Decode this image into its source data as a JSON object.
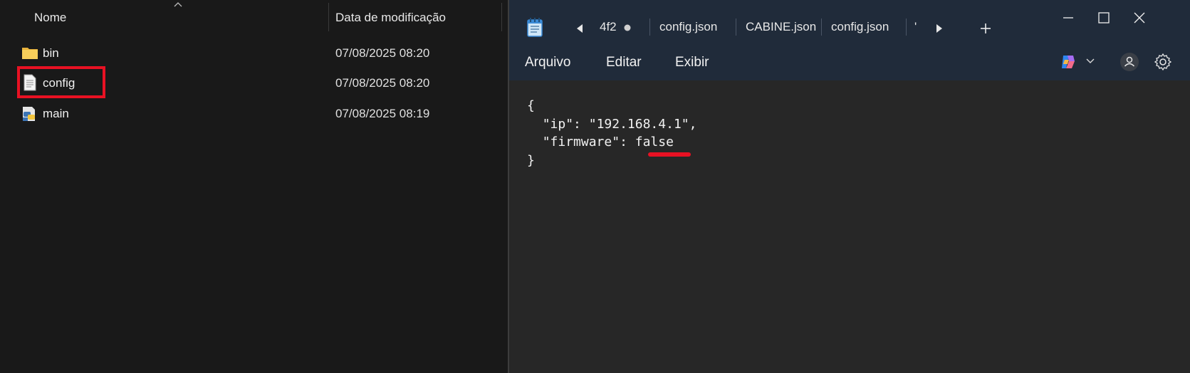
{
  "explorer": {
    "columns": {
      "name": "Nome",
      "date": "Data de modificação"
    },
    "rows": [
      {
        "name": "bin",
        "date": "07/08/2025 08:20",
        "icon": "folder-icon"
      },
      {
        "name": "config",
        "date": "07/08/2025 08:20",
        "icon": "text-file-icon"
      },
      {
        "name": "main",
        "date": "07/08/2025 08:19",
        "icon": "python-file-icon"
      }
    ],
    "highlight_color": "#e81123"
  },
  "notepad": {
    "tabs": [
      {
        "label": "4f2"
      },
      {
        "label": "config.json"
      },
      {
        "label": "CABINE.json"
      },
      {
        "label": "config.json"
      },
      {
        "label": "'"
      }
    ],
    "menu": {
      "file": "Arquivo",
      "edit": "Editar",
      "view": "Exibir"
    },
    "content": {
      "open_brace": "{",
      "line1_key": "\"ip\"",
      "line1_sep": ": ",
      "line1_value": "\"192.168.4.1\",",
      "line2_key": "\"firmware\"",
      "line2_sep": ": ",
      "line2_value": "false",
      "close_brace": "}"
    },
    "accent_color": "#202b3a"
  }
}
